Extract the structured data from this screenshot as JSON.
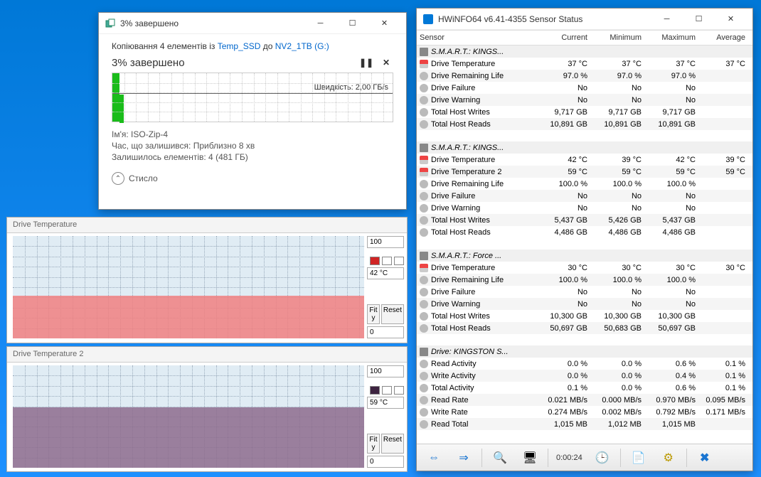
{
  "copy_dialog": {
    "title_pct": "3% завершено",
    "copy_line_prefix": "Копіювання 4 елементів із ",
    "src": "Temp_SSD",
    "mid": " до ",
    "dst": "NV2_1TB (G:)",
    "progress_text": "3% завершено",
    "speed_label": "Швидкість: 2,00 ГБ/s",
    "name_label": "Ім'я: ISO-Zip-4",
    "time_label": "Час, що залишився: Приблизно 8 хв",
    "items_label": "Залишилось елементів: 4 (481 ГБ)",
    "less": "Стисло"
  },
  "hwi": {
    "title": "HWiNFO64 v6.41-4355 Sensor Status",
    "cols": {
      "c0": "Sensor",
      "c1": "Current",
      "c2": "Minimum",
      "c3": "Maximum",
      "c4": "Average"
    },
    "groups": [
      {
        "name": "S.M.A.R.T.: KINGS...",
        "rows": [
          {
            "icon": "temp",
            "name": "Drive Temperature",
            "c": "37 °C",
            "mn": "37 °C",
            "mx": "37 °C",
            "av": "37 °C"
          },
          {
            "icon": "grey",
            "name": "Drive Remaining Life",
            "c": "97.0 %",
            "mn": "97.0 %",
            "mx": "97.0 %",
            "av": ""
          },
          {
            "icon": "grey",
            "name": "Drive Failure",
            "c": "No",
            "mn": "No",
            "mx": "No",
            "av": ""
          },
          {
            "icon": "grey",
            "name": "Drive Warning",
            "c": "No",
            "mn": "No",
            "mx": "No",
            "av": ""
          },
          {
            "icon": "grey",
            "name": "Total Host Writes",
            "c": "9,717 GB",
            "mn": "9,717 GB",
            "mx": "9,717 GB",
            "av": ""
          },
          {
            "icon": "grey",
            "name": "Total Host Reads",
            "c": "10,891 GB",
            "mn": "10,891 GB",
            "mx": "10,891 GB",
            "av": ""
          }
        ]
      },
      {
        "name": "S.M.A.R.T.: KINGS...",
        "rows": [
          {
            "icon": "temp",
            "name": "Drive Temperature",
            "c": "42 °C",
            "mn": "39 °C",
            "mx": "42 °C",
            "av": "39 °C"
          },
          {
            "icon": "temp",
            "name": "Drive Temperature 2",
            "c": "59 °C",
            "mn": "59 °C",
            "mx": "59 °C",
            "av": "59 °C"
          },
          {
            "icon": "grey",
            "name": "Drive Remaining Life",
            "c": "100.0 %",
            "mn": "100.0 %",
            "mx": "100.0 %",
            "av": ""
          },
          {
            "icon": "grey",
            "name": "Drive Failure",
            "c": "No",
            "mn": "No",
            "mx": "No",
            "av": ""
          },
          {
            "icon": "grey",
            "name": "Drive Warning",
            "c": "No",
            "mn": "No",
            "mx": "No",
            "av": ""
          },
          {
            "icon": "grey",
            "name": "Total Host Writes",
            "c": "5,437 GB",
            "mn": "5,426 GB",
            "mx": "5,437 GB",
            "av": ""
          },
          {
            "icon": "grey",
            "name": "Total Host Reads",
            "c": "4,486 GB",
            "mn": "4,486 GB",
            "mx": "4,486 GB",
            "av": ""
          }
        ]
      },
      {
        "name": "S.M.A.R.T.: Force ...",
        "rows": [
          {
            "icon": "temp",
            "name": "Drive Temperature",
            "c": "30 °C",
            "mn": "30 °C",
            "mx": "30 °C",
            "av": "30 °C"
          },
          {
            "icon": "grey",
            "name": "Drive Remaining Life",
            "c": "100.0 %",
            "mn": "100.0 %",
            "mx": "100.0 %",
            "av": ""
          },
          {
            "icon": "grey",
            "name": "Drive Failure",
            "c": "No",
            "mn": "No",
            "mx": "No",
            "av": ""
          },
          {
            "icon": "grey",
            "name": "Drive Warning",
            "c": "No",
            "mn": "No",
            "mx": "No",
            "av": ""
          },
          {
            "icon": "grey",
            "name": "Total Host Writes",
            "c": "10,300 GB",
            "mn": "10,300 GB",
            "mx": "10,300 GB",
            "av": ""
          },
          {
            "icon": "grey",
            "name": "Total Host Reads",
            "c": "50,697 GB",
            "mn": "50,683 GB",
            "mx": "50,697 GB",
            "av": ""
          }
        ]
      },
      {
        "name": "Drive: KINGSTON S...",
        "rows": [
          {
            "icon": "grey",
            "name": "Read Activity",
            "c": "0.0 %",
            "mn": "0.0 %",
            "mx": "0.6 %",
            "av": "0.1 %"
          },
          {
            "icon": "grey",
            "name": "Write Activity",
            "c": "0.0 %",
            "mn": "0.0 %",
            "mx": "0.4 %",
            "av": "0.1 %"
          },
          {
            "icon": "grey",
            "name": "Total Activity",
            "c": "0.1 %",
            "mn": "0.0 %",
            "mx": "0.6 %",
            "av": "0.1 %"
          },
          {
            "icon": "grey",
            "name": "Read Rate",
            "c": "0.021 MB/s",
            "mn": "0.000 MB/s",
            "mx": "0.970 MB/s",
            "av": "0.095 MB/s"
          },
          {
            "icon": "grey",
            "name": "Write Rate",
            "c": "0.274 MB/s",
            "mn": "0.002 MB/s",
            "mx": "0.792 MB/s",
            "av": "0.171 MB/s"
          },
          {
            "icon": "grey",
            "name": "Read Total",
            "c": "1,015 MB",
            "mn": "1,012 MB",
            "mx": "1,015 MB",
            "av": ""
          }
        ]
      }
    ],
    "time": "0:00:24"
  },
  "temp1": {
    "title": "Drive Temperature",
    "max": "100",
    "val": "42 °C",
    "min": "0",
    "fit": "Fit y",
    "reset": "Reset",
    "swatch": "#d02424"
  },
  "temp2": {
    "title": "Drive Temperature 2",
    "max": "100",
    "val": "59 °C",
    "min": "0",
    "fit": "Fit y",
    "reset": "Reset",
    "swatch": "#3d2340"
  },
  "chart_data": [
    {
      "type": "line",
      "title": "Drive Temperature",
      "ylabel": "°C",
      "ylim": [
        0,
        100
      ],
      "series": [
        {
          "name": "Current",
          "values": [
            42,
            42,
            42,
            42,
            42,
            42,
            42,
            42,
            42,
            42
          ]
        }
      ]
    },
    {
      "type": "line",
      "title": "Drive Temperature 2",
      "ylabel": "°C",
      "ylim": [
        0,
        100
      ],
      "series": [
        {
          "name": "Current",
          "values": [
            59,
            59,
            59,
            59,
            59,
            59,
            59,
            59,
            59,
            59
          ]
        }
      ]
    }
  ]
}
